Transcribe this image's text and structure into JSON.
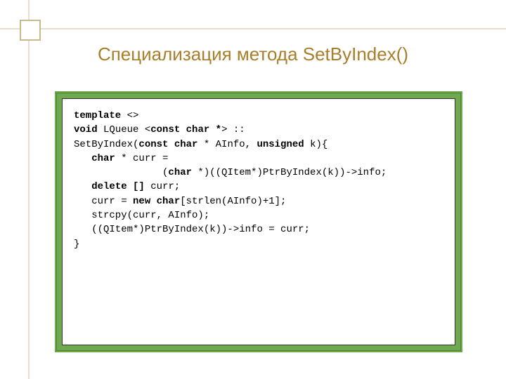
{
  "title": "Специализация метода SetByIndex()",
  "code": {
    "l1a": "template",
    "l1b": " <>",
    "l2a": "void",
    "l2b": " LQueue <",
    "l2c": "const char *",
    "l2d": "> ::",
    "l3a": "SetByIndex(",
    "l3b": "const char",
    "l3c": " * AInfo, ",
    "l3d": "unsigned",
    "l3e": " k){",
    "l4a": "   ",
    "l4b": "char",
    "l4c": " * curr =",
    "l5a": "               (",
    "l5b": "char",
    "l5c": " *)((QItem*)PtrByIndex(k))->info;",
    "l6a": "   ",
    "l6b": "delete []",
    "l6c": " curr;",
    "l7a": "   curr = ",
    "l7b": "new char",
    "l7c": "[strlen(AInfo)+1];",
    "l8": "   strcpy(curr, AInfo);",
    "l9": "   ((QItem*)PtrByIndex(k))->info = curr;",
    "l10": "}"
  }
}
